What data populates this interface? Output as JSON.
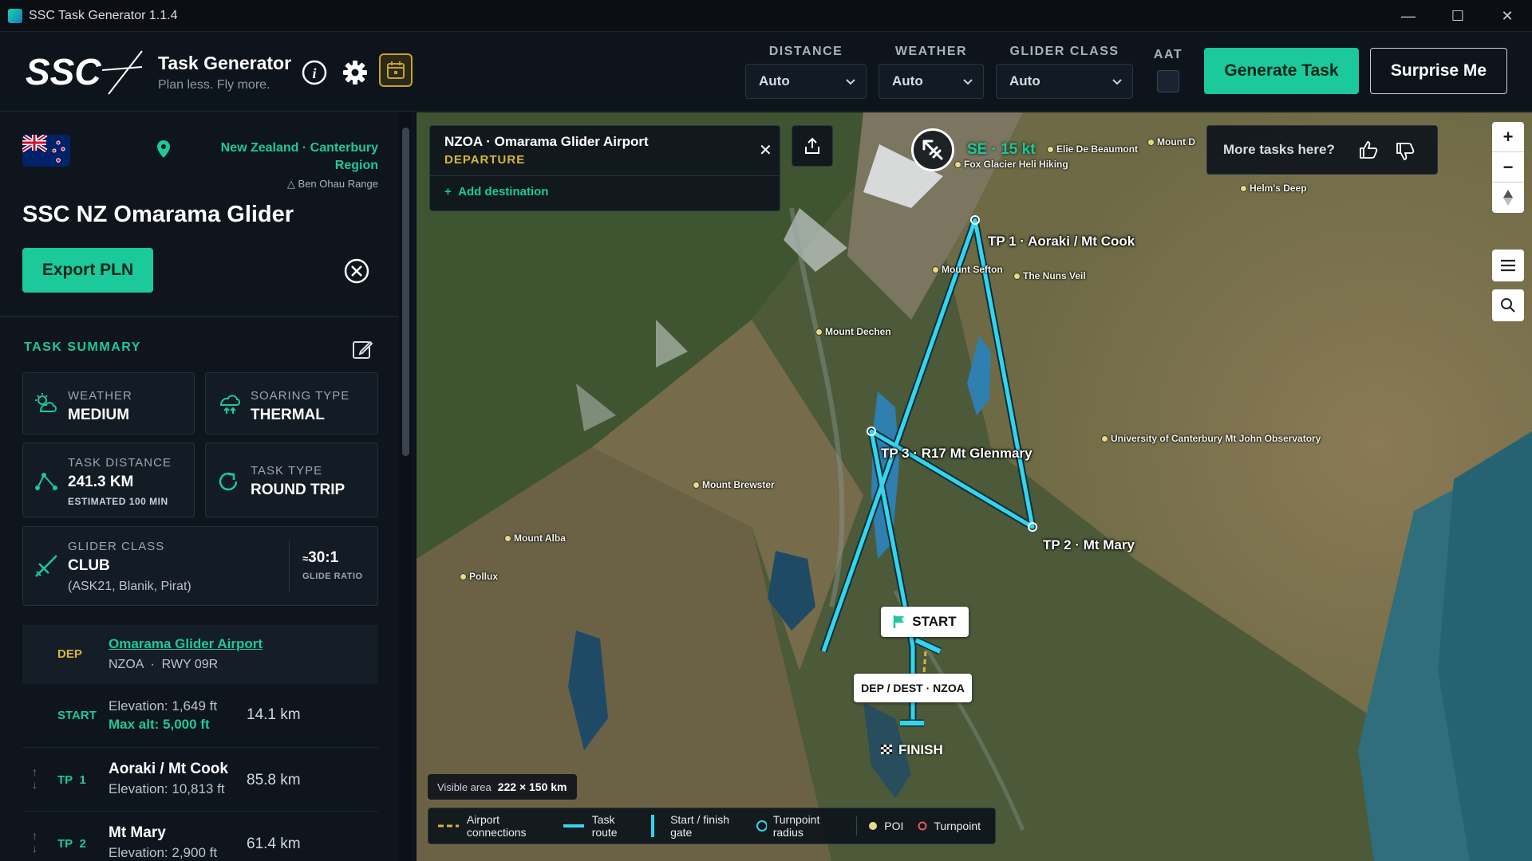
{
  "window": {
    "title": "SSC Task Generator 1.1.4",
    "controls": [
      "—",
      "☐",
      "✕"
    ]
  },
  "header": {
    "logo_text": "SSC",
    "brand_title": "Task Generator",
    "brand_subtitle": "Plan less. Fly more.",
    "distance_label": "DISTANCE",
    "distance_value": "Auto",
    "weather_label": "WEATHER",
    "weather_value": "Auto",
    "glider_class_label": "GLIDER CLASS",
    "glider_class_value": "Auto",
    "aat_label": "AAT",
    "generate_label": "Generate Task",
    "surprise_label": "Surprise Me",
    "accent": "#1cc99a"
  },
  "sidebar": {
    "region": "New Zealand · Canterbury Region",
    "range": "Ben Ohau Range",
    "airport_title": "SSC NZ Omarama Glider",
    "export_label": "Export PLN",
    "summary_title": "TASK SUMMARY",
    "cards": {
      "weather_label": "WEATHER",
      "weather_value": "MEDIUM",
      "soaring_label": "SOARING TYPE",
      "soaring_value": "THERMAL",
      "distance_label": "TASK DISTANCE",
      "distance_value": "241.3 KM",
      "distance_sub": "ESTIMATED 100 MIN",
      "type_label": "TASK TYPE",
      "type_value": "ROUND TRIP",
      "glider_label": "GLIDER CLASS",
      "glider_value": "CLUB",
      "glider_models": "(ASK21, Blanik, Pirat)",
      "ratio_value": "30:1",
      "ratio_prefix": "≈",
      "ratio_label": "GLIDE RATIO"
    },
    "route": {
      "dep_label": "DEP",
      "dep_name": "Omarama Glider Airport",
      "dep_code": "NZOA",
      "dep_sep": "·",
      "dep_rwy": "RWY 09R",
      "start_label": "START",
      "start_elev": "Elevation: 1,649 ft",
      "start_maxalt": "Max alt: 5,000 ft",
      "start_dist": "14.1 km",
      "tp1_label": "TP",
      "tp1_num": "1",
      "tp1_name": "Aoraki / Mt Cook",
      "tp1_elev": "Elevation: 10,813 ft",
      "tp1_dist": "85.8 km",
      "tp2_label": "TP",
      "tp2_num": "2",
      "tp2_name": "Mt Mary",
      "tp2_elev": "Elevation: 2,900 ft",
      "tp2_dist": "61.4 km"
    }
  },
  "map": {
    "dest_name": "NZOA · Omarama Glider Airport",
    "dest_type": "DEPARTURE",
    "add_destination": "Add destination",
    "wind": "SE · 15 kt",
    "more_tasks": "More tasks here?",
    "visible_area_label": "Visible area",
    "visible_area_value": "222 × 150 km",
    "start_label": "START",
    "depdest_label": "DEP / DEST · NZOA",
    "finish_label": "FINISH",
    "route_color": "#35d4ee",
    "turnpoints": {
      "tp1": "TP 1 · Aoraki / Mt Cook",
      "tp2": "TP 2 · Mt Mary",
      "tp3": "TP 3 · R17 Mt Glenmary"
    },
    "places": {
      "elie": "Elie De Beaumont",
      "mountd": "Mount D",
      "fox": "Fox Glacier Heli Hiking",
      "helms": "Helm's Deep",
      "sefton": "Mount Sefton",
      "nuns": "The Nuns Veil",
      "dechen": "Mount Dechen",
      "ucmj": "University of Canterbury Mt John Observatory",
      "brewster": "Mount Brewster",
      "alba": "Mount Alba",
      "pollux": "Pollux"
    },
    "legend": {
      "airport": "Airport connections",
      "route": "Task route",
      "gate": "Start / finish gate",
      "radius": "Turnpoint radius",
      "poi": "POI",
      "turnpoint": "Turnpoint"
    },
    "zoom_in": "+",
    "zoom_out": "−"
  }
}
